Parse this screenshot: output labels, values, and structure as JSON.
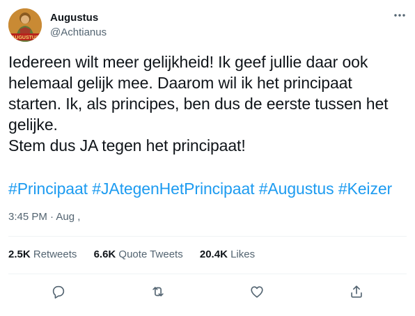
{
  "author": {
    "display_name": "Augustus",
    "handle": "@Achtianus",
    "avatar_caption": "AUGUSTUS"
  },
  "tweet": {
    "lines": [
      "Iedereen wilt meer gelijkheid! Ik geef jullie daar ook",
      "helemaal gelijk mee. Daarom wil ik het principaat",
      "starten. Ik, als principes, ben dus de eerste tussen het",
      "gelijke.",
      "Stem dus JA tegen het principaat!"
    ],
    "hashtags": [
      "#Principaat",
      "#JAtegenHetPrincipaat",
      "#Augustus",
      "#Keizer"
    ]
  },
  "meta": {
    "timestamp": "3:45 PM · Aug ,"
  },
  "stats": {
    "retweets_count": "2.5K",
    "retweets_label": "Retweets",
    "quotes_count": "6.6K",
    "quotes_label": "Quote Tweets",
    "likes_count": "20.4K",
    "likes_label": "Likes"
  },
  "colors": {
    "link": "#1d9bf0",
    "secondary_text": "#536471",
    "primary_text": "#0f1419",
    "divider": "#eff3f4"
  },
  "icons": {
    "more": "more-horizontal-icon",
    "reply": "reply-icon",
    "retweet": "retweet-icon",
    "like": "heart-icon",
    "share": "share-icon"
  }
}
